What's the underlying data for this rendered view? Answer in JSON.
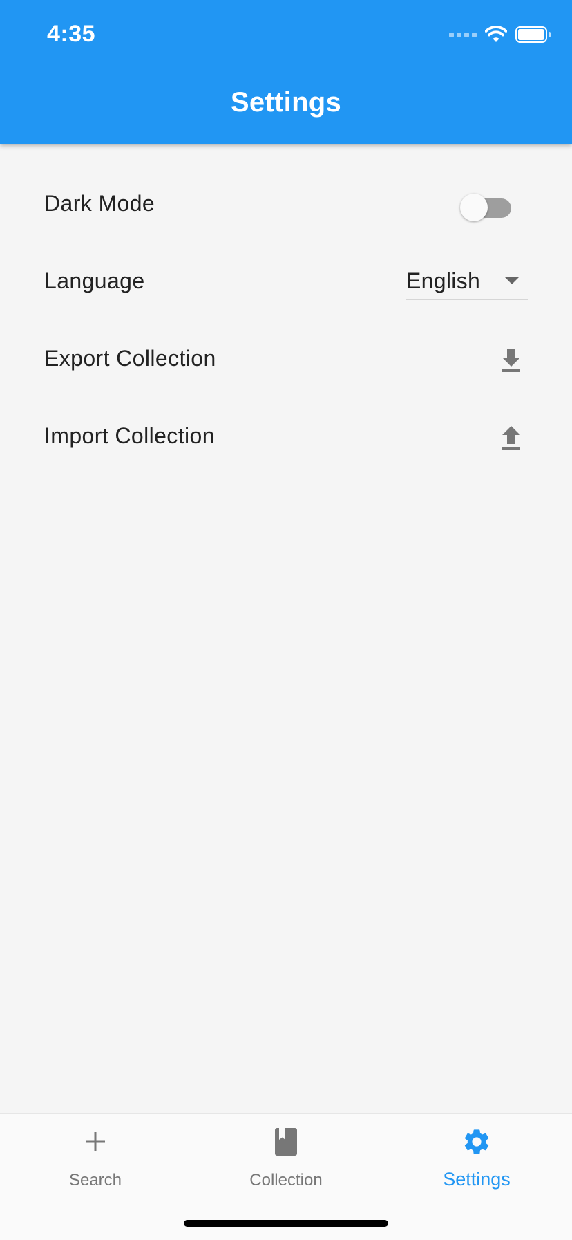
{
  "status_bar": {
    "time": "4:35",
    "signal_icon": "signal-dots-icon",
    "wifi_icon": "wifi-icon",
    "battery_icon": "battery-full-icon"
  },
  "header": {
    "title": "Settings",
    "background_color": "#2196f3"
  },
  "settings": {
    "dark_mode": {
      "label": "Dark Mode",
      "enabled": false
    },
    "language": {
      "label": "Language",
      "selected": "English"
    },
    "export": {
      "label": "Export Collection",
      "icon": "download-icon"
    },
    "import": {
      "label": "Import Collection",
      "icon": "upload-icon"
    }
  },
  "bottom_nav": {
    "items": [
      {
        "label": "Search",
        "icon": "add-icon",
        "active": false
      },
      {
        "label": "Collection",
        "icon": "book-icon",
        "active": false
      },
      {
        "label": "Settings",
        "icon": "gear-icon",
        "active": true
      }
    ],
    "active_color": "#2196f3",
    "inactive_color": "#777777"
  }
}
